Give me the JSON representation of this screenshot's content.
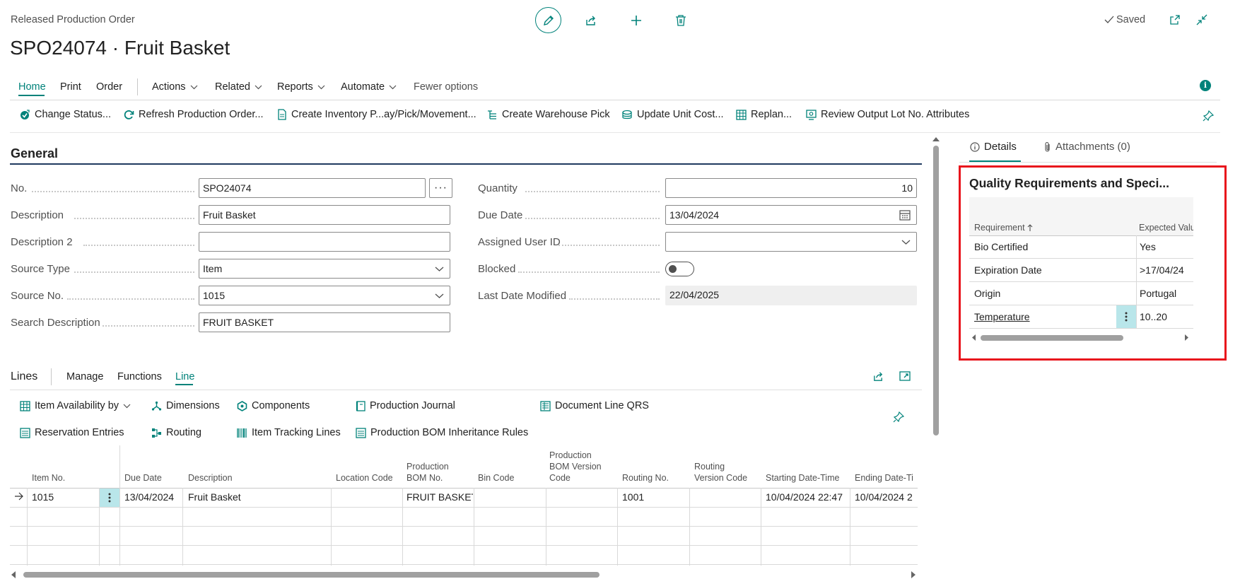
{
  "header": {
    "caption": "Released Production Order",
    "title": "SPO24074 · Fruit Basket",
    "saved": "Saved"
  },
  "menu": {
    "home": "Home",
    "print": "Print",
    "order": "Order",
    "actions": "Actions",
    "related": "Related",
    "reports": "Reports",
    "automate": "Automate",
    "fewer": "Fewer options"
  },
  "actions": {
    "change_status": "Change Status...",
    "refresh": "Refresh Production Order...",
    "create_inventory": "Create Inventory P...ay/Pick/Movement...",
    "create_warehouse": "Create Warehouse Pick",
    "update_cost": "Update Unit Cost...",
    "replan": "Replan...",
    "review_output": "Review Output Lot No. Attributes"
  },
  "general": {
    "heading": "General",
    "no_label": "No.",
    "no_value": "SPO24074",
    "desc_label": "Description",
    "desc_value": "Fruit Basket",
    "desc2_label": "Description 2",
    "desc2_value": "",
    "source_type_label": "Source Type",
    "source_type_value": "Item",
    "source_no_label": "Source No.",
    "source_no_value": "1015",
    "search_desc_label": "Search Description",
    "search_desc_value": "FRUIT BASKET",
    "qty_label": "Quantity",
    "qty_value": "10",
    "due_label": "Due Date",
    "due_value": "13/04/2024",
    "user_label": "Assigned User ID",
    "user_value": "",
    "blocked_label": "Blocked",
    "last_mod_label": "Last Date Modified",
    "last_mod_value": "22/04/2025"
  },
  "lines": {
    "title": "Lines",
    "manage": "Manage",
    "functions": "Functions",
    "line": "Line",
    "btn_avail": "Item Availability by",
    "btn_dimensions": "Dimensions",
    "btn_components": "Components",
    "btn_journal": "Production Journal",
    "btn_qrs": "Document Line QRS",
    "btn_reservation": "Reservation Entries",
    "btn_routing": "Routing",
    "btn_tracking": "Item Tracking Lines",
    "btn_bom_rules": "Production BOM Inheritance Rules",
    "columns": {
      "item_no": "Item No.",
      "due_date": "Due Date",
      "description": "Description",
      "location": "Location Code",
      "bom_no_1": "Production",
      "bom_no_2": "BOM No.",
      "bin": "Bin Code",
      "bomver_1": "Production",
      "bomver_2": "BOM Version",
      "bomver_3": "Code",
      "routing_no": "Routing No.",
      "routing_ver_1": "Routing",
      "routing_ver_2": "Version Code",
      "start": "Starting Date-Time",
      "end": "Ending Date-Ti"
    },
    "row": {
      "item_no": "1015",
      "due_date": "13/04/2024",
      "description": "Fruit Basket",
      "location": "",
      "bom_no": "FRUIT BASKET",
      "bin": "",
      "bomver": "",
      "routing_no": "1001",
      "routing_ver": "",
      "start": "10/04/2024 22:47",
      "end": "10/04/2024 2"
    }
  },
  "factbox": {
    "tab_details": "Details",
    "tab_attachments": "Attachments (0)",
    "title": "Quality Requirements and Speci...",
    "col_requirement": "Requirement",
    "col_expected": "Expected Valu",
    "rows": [
      {
        "req": "Bio Certified",
        "val": "Yes"
      },
      {
        "req": "Expiration Date",
        "val": ">17/04/24"
      },
      {
        "req": "Origin",
        "val": "Portugal"
      },
      {
        "req": "Temperature",
        "val": "10..20"
      }
    ]
  },
  "colors": {
    "accent": "#00827a",
    "highlight_border": "#e8141c",
    "selected_cell": "#b9e6ea"
  }
}
